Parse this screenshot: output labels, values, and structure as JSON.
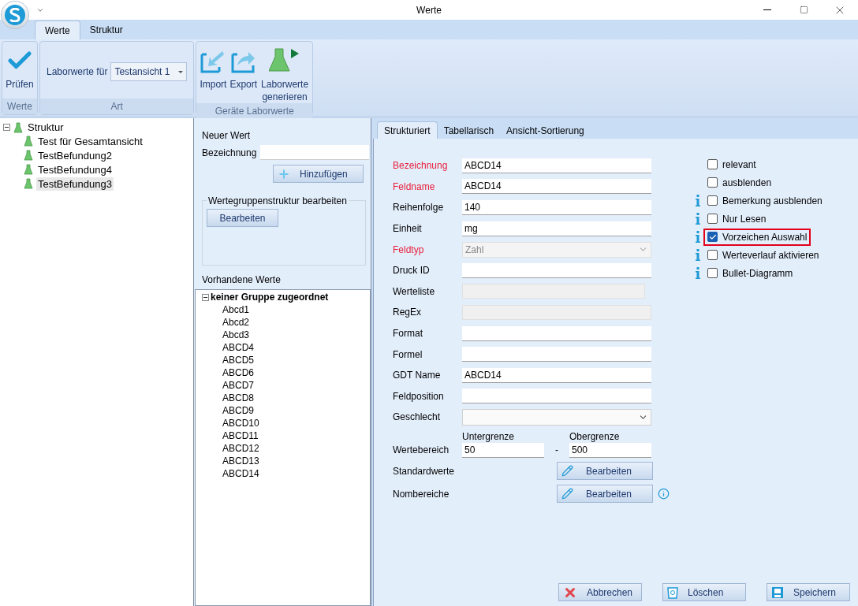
{
  "window": {
    "title": "Werte"
  },
  "ribbon": {
    "tabs": [
      {
        "label": "Werte",
        "selected": true
      },
      {
        "label": "Struktur",
        "selected": false
      }
    ],
    "groups": [
      {
        "title": "Werte",
        "kind": "check",
        "buttons": [
          {
            "label": "Prüfen",
            "kind": "check"
          }
        ]
      },
      {
        "title": "Art",
        "kind": "select",
        "label": "Laborwerte für",
        "value": "Testansicht 1"
      },
      {
        "title": "Geräte Laborwerte",
        "kind": "buttons",
        "buttons": [
          {
            "label": "Import",
            "kind": "import"
          },
          {
            "label": "Export",
            "kind": "export"
          },
          {
            "label": "Laborwerte generieren",
            "kind": "flask"
          }
        ]
      }
    ]
  },
  "structure_tree": {
    "label": "Struktur",
    "expanded": true,
    "selected": false,
    "children": [
      {
        "label": "Test für Gesamtansicht",
        "selected": false
      },
      {
        "label": "TestBefundung2",
        "selected": false
      },
      {
        "label": "TestBefundung4",
        "selected": false
      },
      {
        "label": "TestBefundung3",
        "selected": true
      }
    ]
  },
  "new_value": {
    "title": "Neuer Wert",
    "label": "Bezeichnung",
    "button": "Hinzufügen"
  },
  "group_structure": {
    "title": "Wertegruppenstruktur bearbeiten",
    "button": "Bearbeiten"
  },
  "existing_values": {
    "title": "Vorhandene Werte",
    "tree": {
      "label": "keiner Gruppe zugeordnet",
      "expanded": true,
      "children": [
        {
          "label": "Abcd1"
        },
        {
          "label": "Abcd2"
        },
        {
          "label": "Abcd3"
        },
        {
          "label": "ABCD4"
        },
        {
          "label": "ABCD5"
        },
        {
          "label": "ABCD6"
        },
        {
          "label": "ABCD7"
        },
        {
          "label": "ABCD8"
        },
        {
          "label": "ABCD9"
        },
        {
          "label": "ABCD10"
        },
        {
          "label": "ABCD11"
        },
        {
          "label": "ABCD12"
        },
        {
          "label": "ABCD13"
        },
        {
          "label": "ABCD14"
        }
      ]
    }
  },
  "detail_tabs": [
    {
      "label": "Strukturiert",
      "selected": true
    },
    {
      "label": "Tabellarisch",
      "selected": false
    },
    {
      "label": "Ansicht-Sortierung",
      "selected": false
    }
  ],
  "fields": [
    {
      "label": "Bezeichnung",
      "required": true,
      "kind": "text",
      "value": "ABCD14"
    },
    {
      "label": "Feldname",
      "required": true,
      "kind": "text",
      "value": "ABCD14"
    },
    {
      "label": "Reihenfolge",
      "required": false,
      "kind": "text",
      "value": "140"
    },
    {
      "label": "Einheit",
      "required": false,
      "kind": "text",
      "value": "mg"
    },
    {
      "label": "Feldtyp",
      "required": true,
      "kind": "select-disabled",
      "value": "Zahl"
    },
    {
      "label": "Druck ID",
      "required": false,
      "kind": "text"
    },
    {
      "label": "Werteliste",
      "required": false,
      "kind": "disabled-short"
    },
    {
      "label": "RegEx",
      "required": false,
      "kind": "disabled"
    },
    {
      "label": "Format",
      "required": false,
      "kind": "text"
    },
    {
      "label": "Formel",
      "required": false,
      "kind": "text"
    },
    {
      "label": "GDT Name",
      "required": false,
      "kind": "text",
      "value": "ABCD14"
    },
    {
      "label": "Feldposition",
      "required": false,
      "kind": "text"
    },
    {
      "label": "Geschlecht",
      "required": false,
      "kind": "select"
    }
  ],
  "range": {
    "label": "Wertebereich",
    "lower_label": "Untergrenze",
    "lower": "50",
    "separator": "-",
    "upper_label": "Obergrenze",
    "upper": "500"
  },
  "edit_rows": [
    {
      "label": "Standardwerte",
      "button": "Bearbeiten",
      "info": false
    },
    {
      "label": "Nombereiche",
      "button": "Bearbeiten",
      "info": true
    }
  ],
  "checkboxes": [
    {
      "label": "relevant",
      "checked": false,
      "info": false,
      "highlighted": false
    },
    {
      "label": "ausblenden",
      "checked": false,
      "info": false,
      "highlighted": false
    },
    {
      "label": "Bemerkung ausblenden",
      "checked": false,
      "info": true,
      "highlighted": false
    },
    {
      "label": "Nur Lesen",
      "checked": false,
      "info": true,
      "highlighted": false
    },
    {
      "label": "Vorzeichen Auswahl",
      "checked": true,
      "info": true,
      "highlighted": true
    },
    {
      "label": "Werteverlauf aktivieren",
      "checked": false,
      "info": true,
      "highlighted": false
    },
    {
      "label": "Bullet-Diagramm",
      "checked": false,
      "info": true,
      "highlighted": false
    }
  ],
  "footer_buttons": [
    {
      "label": "Abbrechen",
      "kind": "cancel"
    },
    {
      "label": "Löschen",
      "kind": "delete"
    },
    {
      "label": "Speichern",
      "kind": "save"
    }
  ]
}
